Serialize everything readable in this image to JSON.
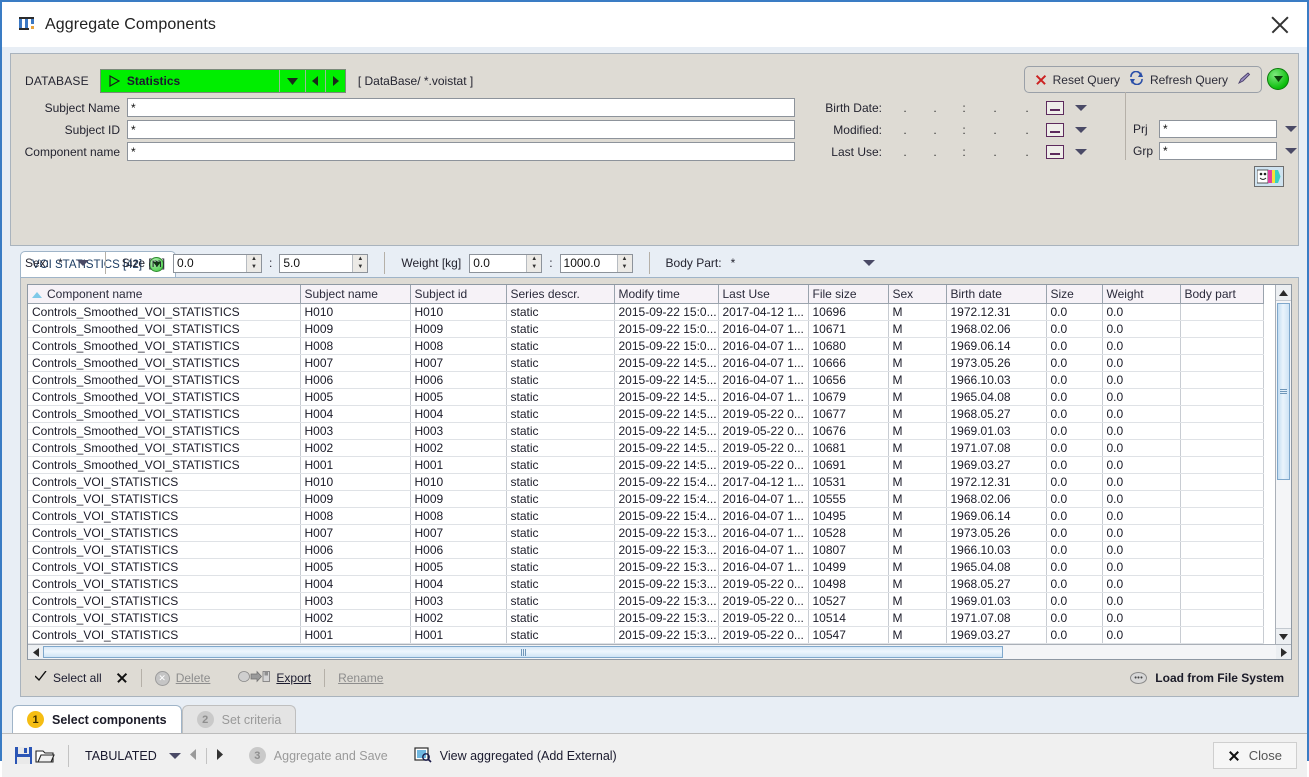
{
  "window": {
    "title": "Aggregate Components",
    "icon": "aggregate-icon",
    "close_tooltip": "Close"
  },
  "query": {
    "database_label": "DATABASE",
    "database_value": "Statistics",
    "database_path": "[ DataBase/ *.voistat ]",
    "reset_query": "Reset Query",
    "refresh_query": "Refresh Query",
    "fields": [
      {
        "label": "Subject Name",
        "value": "*"
      },
      {
        "label": "Subject ID",
        "value": "*"
      },
      {
        "label": "Component name",
        "value": "*"
      }
    ],
    "dates": [
      {
        "label": "Birth Date:",
        "d1": ".",
        "d2": ".",
        "sep": ":",
        "t1": ".",
        "t2": "."
      },
      {
        "label": "Modified:",
        "d1": ".",
        "d2": ".",
        "sep": ":",
        "t1": ".",
        "t2": "."
      },
      {
        "label": "Last Use:",
        "d1": ".",
        "d2": ".",
        "sep": ":",
        "t1": ".",
        "t2": "."
      }
    ],
    "prj": {
      "label": "Prj",
      "value": "*"
    },
    "grp": {
      "label": "Grp",
      "value": "*"
    },
    "filters": {
      "sex_label": "Sex:",
      "sex_value": "*",
      "size_label": "Size [m]",
      "size_min": "0.0",
      "size_sep": ":",
      "size_max": "5.0",
      "weight_label": "Weight [kg]",
      "weight_min": "0.0",
      "weight_sep": ":",
      "weight_max": "1000.0",
      "bodypart_label": "Body Part:",
      "bodypart_value": "*"
    }
  },
  "voi_tab": {
    "label": "VOI STATISTICS [42]"
  },
  "table": {
    "columns": [
      "Component name",
      "Subject name",
      "Subject id",
      "Series descr.",
      "Modify time",
      "Last Use",
      "File size",
      "Sex",
      "Birth date",
      "Size",
      "Weight",
      "Body part"
    ],
    "sorted_column": "Component name",
    "sort_direction": "ascending",
    "rows": [
      [
        "Controls_Smoothed_VOI_STATISTICS",
        "H010",
        "H010",
        "static",
        "2015-09-22 15:0...",
        "2017-04-12 1...",
        "10696",
        "M",
        "1972.12.31",
        "0.0",
        "0.0",
        ""
      ],
      [
        "Controls_Smoothed_VOI_STATISTICS",
        "H009",
        "H009",
        "static",
        "2015-09-22 15:0...",
        "2016-04-07 1...",
        "10671",
        "M",
        "1968.02.06",
        "0.0",
        "0.0",
        ""
      ],
      [
        "Controls_Smoothed_VOI_STATISTICS",
        "H008",
        "H008",
        "static",
        "2015-09-22 15:0...",
        "2016-04-07 1...",
        "10680",
        "M",
        "1969.06.14",
        "0.0",
        "0.0",
        ""
      ],
      [
        "Controls_Smoothed_VOI_STATISTICS",
        "H007",
        "H007",
        "static",
        "2015-09-22 14:5...",
        "2016-04-07 1...",
        "10666",
        "M",
        "1973.05.26",
        "0.0",
        "0.0",
        ""
      ],
      [
        "Controls_Smoothed_VOI_STATISTICS",
        "H006",
        "H006",
        "static",
        "2015-09-22 14:5...",
        "2016-04-07 1...",
        "10656",
        "M",
        "1966.10.03",
        "0.0",
        "0.0",
        ""
      ],
      [
        "Controls_Smoothed_VOI_STATISTICS",
        "H005",
        "H005",
        "static",
        "2015-09-22 14:5...",
        "2016-04-07 1...",
        "10679",
        "M",
        "1965.04.08",
        "0.0",
        "0.0",
        ""
      ],
      [
        "Controls_Smoothed_VOI_STATISTICS",
        "H004",
        "H004",
        "static",
        "2015-09-22 14:5...",
        "2019-05-22 0...",
        "10677",
        "M",
        "1968.05.27",
        "0.0",
        "0.0",
        ""
      ],
      [
        "Controls_Smoothed_VOI_STATISTICS",
        "H003",
        "H003",
        "static",
        "2015-09-22 14:5...",
        "2019-05-22 0...",
        "10676",
        "M",
        "1969.01.03",
        "0.0",
        "0.0",
        ""
      ],
      [
        "Controls_Smoothed_VOI_STATISTICS",
        "H002",
        "H002",
        "static",
        "2015-09-22 14:5...",
        "2019-05-22 0...",
        "10681",
        "M",
        "1971.07.08",
        "0.0",
        "0.0",
        ""
      ],
      [
        "Controls_Smoothed_VOI_STATISTICS",
        "H001",
        "H001",
        "static",
        "2015-09-22 14:5...",
        "2019-05-22 0...",
        "10691",
        "M",
        "1969.03.27",
        "0.0",
        "0.0",
        ""
      ],
      [
        "Controls_VOI_STATISTICS",
        "H010",
        "H010",
        "static",
        "2015-09-22 15:4...",
        "2017-04-12 1...",
        "10531",
        "M",
        "1972.12.31",
        "0.0",
        "0.0",
        ""
      ],
      [
        "Controls_VOI_STATISTICS",
        "H009",
        "H009",
        "static",
        "2015-09-22 15:4...",
        "2016-04-07 1...",
        "10555",
        "M",
        "1968.02.06",
        "0.0",
        "0.0",
        ""
      ],
      [
        "Controls_VOI_STATISTICS",
        "H008",
        "H008",
        "static",
        "2015-09-22 15:4...",
        "2016-04-07 1...",
        "10495",
        "M",
        "1969.06.14",
        "0.0",
        "0.0",
        ""
      ],
      [
        "Controls_VOI_STATISTICS",
        "H007",
        "H007",
        "static",
        "2015-09-22 15:3...",
        "2016-04-07 1...",
        "10528",
        "M",
        "1973.05.26",
        "0.0",
        "0.0",
        ""
      ],
      [
        "Controls_VOI_STATISTICS",
        "H006",
        "H006",
        "static",
        "2015-09-22 15:3...",
        "2016-04-07 1...",
        "10807",
        "M",
        "1966.10.03",
        "0.0",
        "0.0",
        ""
      ],
      [
        "Controls_VOI_STATISTICS",
        "H005",
        "H005",
        "static",
        "2015-09-22 15:3...",
        "2016-04-07 1...",
        "10499",
        "M",
        "1965.04.08",
        "0.0",
        "0.0",
        ""
      ],
      [
        "Controls_VOI_STATISTICS",
        "H004",
        "H004",
        "static",
        "2015-09-22 15:3...",
        "2019-05-22 0...",
        "10498",
        "M",
        "1968.05.27",
        "0.0",
        "0.0",
        ""
      ],
      [
        "Controls_VOI_STATISTICS",
        "H003",
        "H003",
        "static",
        "2015-09-22 15:3...",
        "2019-05-22 0...",
        "10527",
        "M",
        "1969.01.03",
        "0.0",
        "0.0",
        ""
      ],
      [
        "Controls_VOI_STATISTICS",
        "H002",
        "H002",
        "static",
        "2015-09-22 15:3...",
        "2019-05-22 0...",
        "10514",
        "M",
        "1971.07.08",
        "0.0",
        "0.0",
        ""
      ],
      [
        "Controls_VOI_STATISTICS",
        "H001",
        "H001",
        "static",
        "2015-09-22 15:3...",
        "2019-05-22 0...",
        "10547",
        "M",
        "1969.03.27",
        "0.0",
        "0.0",
        ""
      ]
    ]
  },
  "table_actions": {
    "select_all": "Select all",
    "delete": "Delete",
    "export": "Export",
    "rename": "Rename",
    "load_from_file_system": "Load from File System"
  },
  "steps": [
    {
      "num": "1",
      "label": "Select components",
      "active": true
    },
    {
      "num": "2",
      "label": "Set criteria",
      "active": false
    }
  ],
  "footer": {
    "format": "TABULATED",
    "aggregate_num": "3",
    "aggregate_label": "Aggregate and Save",
    "view_aggregated": "View aggregated (Add External)",
    "close": "Close"
  },
  "colors": {
    "accent_green": "#00ee00",
    "window_border": "#3a7cc4",
    "panel_bg": "#dedbd4",
    "step_active": "#f5bd13"
  }
}
